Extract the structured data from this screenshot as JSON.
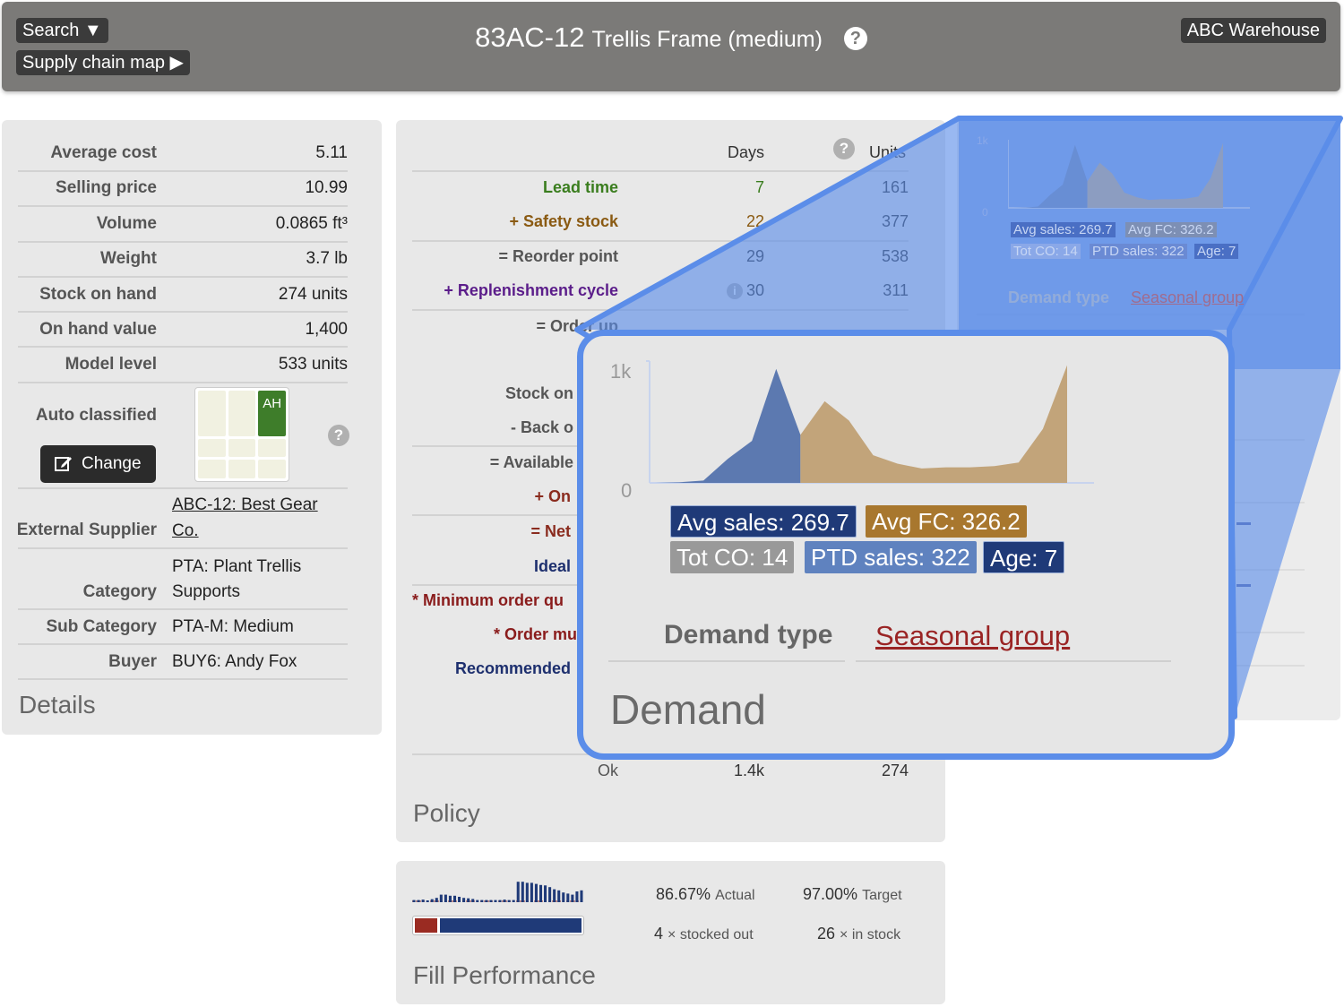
{
  "header": {
    "search_label": "Search ▼",
    "supply_chain_label": "Supply chain map ▶",
    "item_code": "83AC-12",
    "item_name": "Trellis Frame (medium)",
    "help_glyph": "?",
    "warehouse_label": "ABC Warehouse"
  },
  "details": {
    "title": "Details",
    "rows": [
      {
        "label": "Average cost",
        "value": "5.11"
      },
      {
        "label": "Selling price",
        "value": "10.99"
      },
      {
        "label": "Volume",
        "value": "0.0865 ft³"
      },
      {
        "label": "Weight",
        "value": "3.7 lb"
      },
      {
        "label": "Stock on hand",
        "value": "274 units"
      },
      {
        "label": "On hand value",
        "value": "1,400"
      },
      {
        "label": "Model level",
        "value": "533 units"
      }
    ],
    "auto_classified_label": "Auto classified",
    "class_badge": "AH",
    "change_label": "Change",
    "help_glyph": "?",
    "supplier_label": "External Supplier",
    "supplier_line1": "ABC-12: Best Gear",
    "supplier_line2": "Co.",
    "category_label": "Category",
    "category_line1": "PTA: Plant Trellis",
    "category_line2": "Supports",
    "subcategory_label": "Sub Category",
    "subcategory_value": "PTA-M: Medium",
    "buyer_label": "Buyer",
    "buyer_value": "BUY6: Andy Fox"
  },
  "policy": {
    "title": "Policy",
    "col_days": "Days",
    "col_units": "Units",
    "help_glyph": "?",
    "info_glyph": "i",
    "rows": [
      {
        "label": "Lead time",
        "days": "7",
        "units": "161",
        "color": "#3a7d1e"
      },
      {
        "label": "+ Safety stock",
        "days": "22",
        "units": "377",
        "color": "#8a5a12"
      },
      {
        "label": "= Reorder point",
        "days": "29",
        "units": "538",
        "color": "#555555"
      },
      {
        "label": "+ Replenishment cycle",
        "days": "30",
        "units": "311",
        "color": "#5b1d8a"
      },
      {
        "label": "= Order up",
        "days": "",
        "units": "",
        "color": "#555555"
      }
    ],
    "lower_rows": [
      {
        "label": "Stock on",
        "color": "#555555"
      },
      {
        "label": "- Back o",
        "color": "#555555"
      },
      {
        "label": "= Available",
        "color": "#555555"
      },
      {
        "label": "+ On",
        "color": "#8a2b1e"
      },
      {
        "label": "= Net",
        "color": "#8a2b1e"
      },
      {
        "label": "Ideal",
        "color": "#1d2f6e"
      },
      {
        "label": "* Minimum order qu",
        "color": "#8a1c1c"
      },
      {
        "label": "* Order mu",
        "color": "#8a1c1c"
      },
      {
        "label": "Recommended",
        "color": "#1d2f6e"
      }
    ],
    "footer_status": "Ok",
    "footer_days": "1.4k",
    "footer_units": "274"
  },
  "fill_performance": {
    "title": "Fill Performance",
    "actual_value": "86.67%",
    "actual_label": "Actual",
    "target_value": "97.00%",
    "target_label": "Target",
    "stocked_out_count": "4",
    "stocked_out_label": "× stocked out",
    "in_stock_count": "26",
    "in_stock_label": "× in stock",
    "stockout_fraction": 0.1333,
    "bar_fail_color": "#9a2b22",
    "bar_ok_color": "#1f3a78",
    "history_levels": [
      0.1,
      0.1,
      0.12,
      0.08,
      0.14,
      0.2,
      0.35,
      0.35,
      0.3,
      0.3,
      0.25,
      0.2,
      0.18,
      0.15,
      0.1,
      0.1,
      0.1,
      0.1,
      0.1,
      0.1,
      0.12,
      0.1,
      0.1,
      0.95,
      0.95,
      0.9,
      0.9,
      0.85,
      0.8,
      0.78,
      0.7,
      0.6,
      0.55,
      0.45,
      0.4,
      0.35,
      0.5,
      0.55
    ]
  },
  "demand": {
    "title": "Demand",
    "y_top": "1k",
    "y_bottom": "0",
    "avg_sales": "Avg sales: 269.7",
    "avg_fc": "Avg FC: 326.2",
    "tot_co": "Tot CO: 14",
    "ptd_sales": "PTD sales: 322",
    "age": "Age: 7",
    "demand_type_label": "Demand type",
    "demand_type_value": "Seasonal group",
    "colors": {
      "history": "#5c79b0",
      "forecast": "#c2a47a",
      "avg_sales": "#1f3a78",
      "avg_fc": "#a8772e",
      "tot_co": "#999999",
      "ptd_sales": "#5f82bf",
      "age": "#1f3a78",
      "magnifier": "#5b8de9"
    }
  },
  "chart_data": {
    "type": "area",
    "y_range": [
      0,
      1000
    ],
    "y_ticks": [
      "0",
      "1k"
    ],
    "series": [
      {
        "values": [
          0,
          5,
          20,
          200,
          350,
          950,
          400
        ]
      },
      {
        "values": [
          400,
          680,
          520,
          230,
          160,
          120,
          130,
          130,
          140,
          170,
          450,
          980
        ]
      }
    ]
  }
}
